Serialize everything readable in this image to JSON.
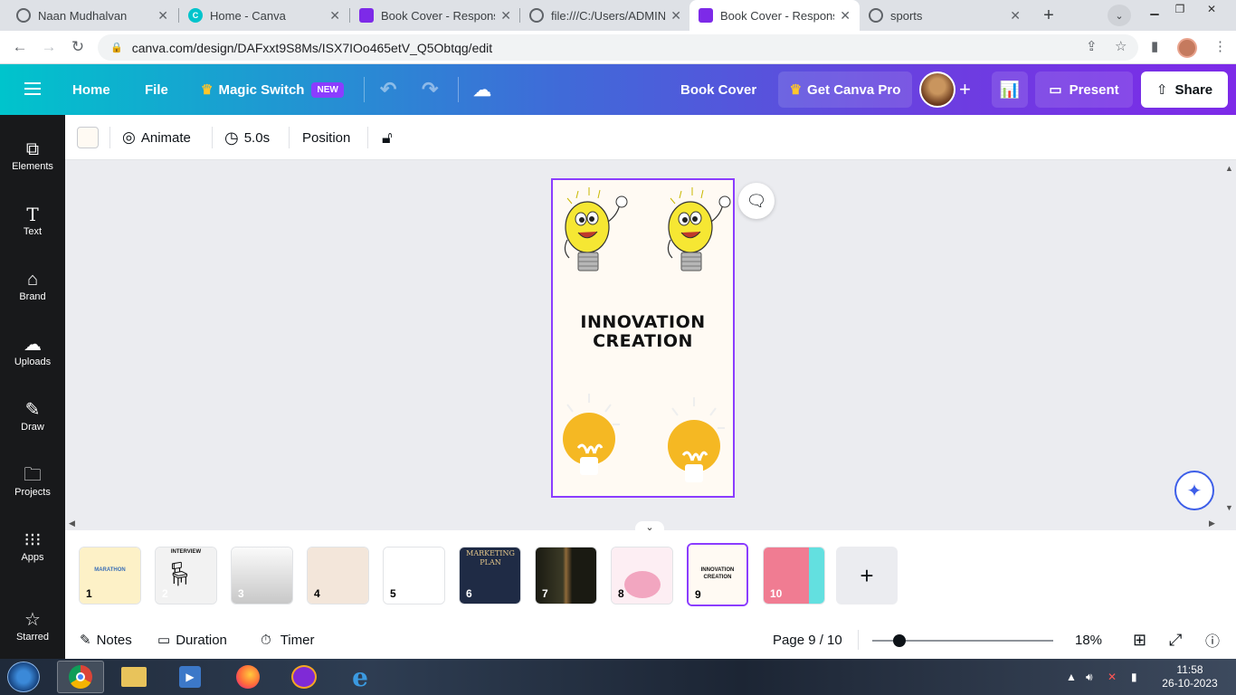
{
  "browser": {
    "tabs": [
      {
        "title": "Naan Mudhalvan",
        "icon": "globe-icon"
      },
      {
        "title": "Home - Canva",
        "icon": "canva-icon"
      },
      {
        "title": "Book Cover - Responsiv",
        "icon": "canva-design-icon"
      },
      {
        "title": "file:///C:/Users/ADMIN/",
        "icon": "globe-icon"
      },
      {
        "title": "Book Cover - Responsiv",
        "icon": "canva-design-icon"
      },
      {
        "title": "sports",
        "icon": "globe-icon"
      }
    ],
    "active_tab": 4,
    "url": "canva.com/design/DAFxxt9S8Ms/ISX7IOo465etV_Q5Obtqg/edit"
  },
  "header": {
    "home_label": "Home",
    "file_label": "File",
    "magic_switch_label": "Magic Switch",
    "new_badge": "NEW",
    "doc_title": "Book Cover",
    "get_pro_label": "Get Canva Pro",
    "present_label": "Present",
    "share_label": "Share"
  },
  "sidebar": {
    "items": [
      {
        "label": "Elements",
        "icon": "elements-icon"
      },
      {
        "label": "Text",
        "icon": "text-icon"
      },
      {
        "label": "Brand",
        "icon": "brand-icon"
      },
      {
        "label": "Uploads",
        "icon": "upload-icon"
      },
      {
        "label": "Draw",
        "icon": "draw-icon"
      },
      {
        "label": "Projects",
        "icon": "folder-icon"
      },
      {
        "label": "Apps",
        "icon": "apps-icon"
      },
      {
        "label": "Starred",
        "icon": "star-icon"
      }
    ]
  },
  "toolbar": {
    "animate_label": "Animate",
    "duration_label": "5.0s",
    "position_label": "Position",
    "bg_color": "#fffaf3"
  },
  "design": {
    "title_line1": "INNOVATION",
    "title_line2": "CREATION"
  },
  "pages": {
    "thumbnails": [
      {
        "num": "1",
        "text": "MARATHON",
        "bg": "#fdf1c7"
      },
      {
        "num": "2",
        "text": "INTERVIEW",
        "bg": "#f2f2f2"
      },
      {
        "num": "3",
        "text": "",
        "bg": "#e6e6e6"
      },
      {
        "num": "4",
        "text": "",
        "bg": "#f3e6da"
      },
      {
        "num": "5",
        "text": "",
        "bg": "#ffffff"
      },
      {
        "num": "6",
        "text": "MARKETING PLAN",
        "bg": "#1f2b45"
      },
      {
        "num": "7",
        "text": "",
        "bg": "#2d2a1e"
      },
      {
        "num": "8",
        "text": "",
        "bg": "#fdeef3"
      },
      {
        "num": "9",
        "text": "INNOVATION CREATION",
        "bg": "#fffaf3"
      },
      {
        "num": "10",
        "text": "",
        "bg": "#f07c92"
      }
    ],
    "active": 9
  },
  "footer": {
    "notes_label": "Notes",
    "duration_label": "Duration",
    "timer_label": "Timer",
    "page_indicator": "Page 9 / 10",
    "zoom": "18%",
    "zoom_fraction": 0.15
  },
  "taskbar": {
    "time": "11:58",
    "date": "26-10-2023"
  }
}
